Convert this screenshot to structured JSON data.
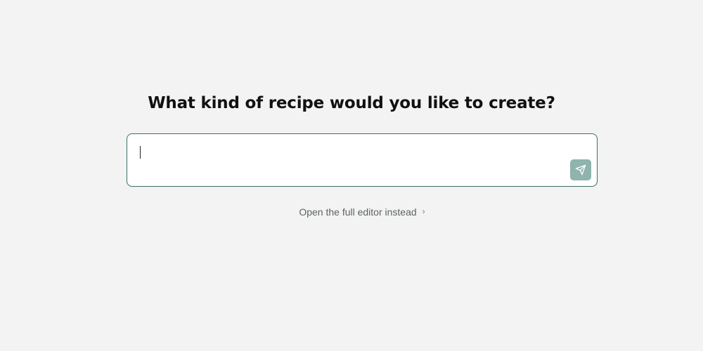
{
  "prompt": {
    "title": "What kind of recipe would you like to create?",
    "input_value": "",
    "input_placeholder": ""
  },
  "send_button": {
    "icon": "send-icon",
    "color": "#8fb3ad"
  },
  "editor_link": {
    "label": "Open the full editor instead",
    "icon": "chevron-right-icon",
    "chevron": "›"
  },
  "colors": {
    "background": "#f2f3f2",
    "input_border": "#3f6e6c",
    "accent": "#8fb3ad"
  }
}
